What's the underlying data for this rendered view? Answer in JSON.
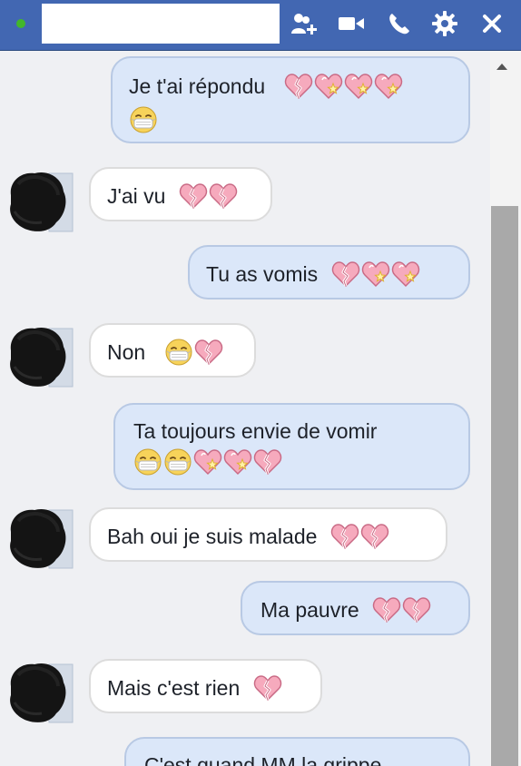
{
  "header": {
    "contact_name": "",
    "icons": [
      "online-status-dot",
      "add-friend-icon",
      "video-call-icon",
      "phone-call-icon",
      "settings-gear-icon",
      "close-icon"
    ]
  },
  "messages": [
    {
      "side": "out",
      "text": "Je t'ai répondu",
      "emojis": [
        "broken-heart",
        "sparkling-heart",
        "sparkling-heart",
        "sparkling-heart",
        "mask-face"
      ]
    },
    {
      "side": "in",
      "text": "J'ai vu",
      "emojis": [
        "broken-heart",
        "broken-heart"
      ]
    },
    {
      "side": "out",
      "text": "Tu as vomis",
      "emojis": [
        "broken-heart",
        "sparkling-heart",
        "sparkling-heart"
      ]
    },
    {
      "side": "in",
      "text": "Non",
      "emojis": [
        "mask-face",
        "broken-heart"
      ]
    },
    {
      "side": "out",
      "text": "Ta toujours envie de vomir",
      "emojis": [
        "mask-face",
        "mask-face",
        "sparkling-heart",
        "sparkling-heart",
        "broken-heart"
      ]
    },
    {
      "side": "in",
      "text": "Bah oui je suis malade",
      "emojis": [
        "broken-heart",
        "broken-heart"
      ]
    },
    {
      "side": "out",
      "text": "Ma pauvre",
      "emojis": [
        "broken-heart",
        "broken-heart"
      ]
    },
    {
      "side": "in",
      "text": "Mais c'est rien",
      "emojis": [
        "broken-heart"
      ]
    },
    {
      "side": "out",
      "text": "C'est quand MM la grippe",
      "emojis": []
    }
  ],
  "colors": {
    "header_bg": "#4267b2",
    "outgoing_bubble": "#dbe7f9",
    "incoming_bubble": "#ffffff",
    "heart_pink": "#f29bb0",
    "mask_face_yellow": "#f7d35a"
  }
}
